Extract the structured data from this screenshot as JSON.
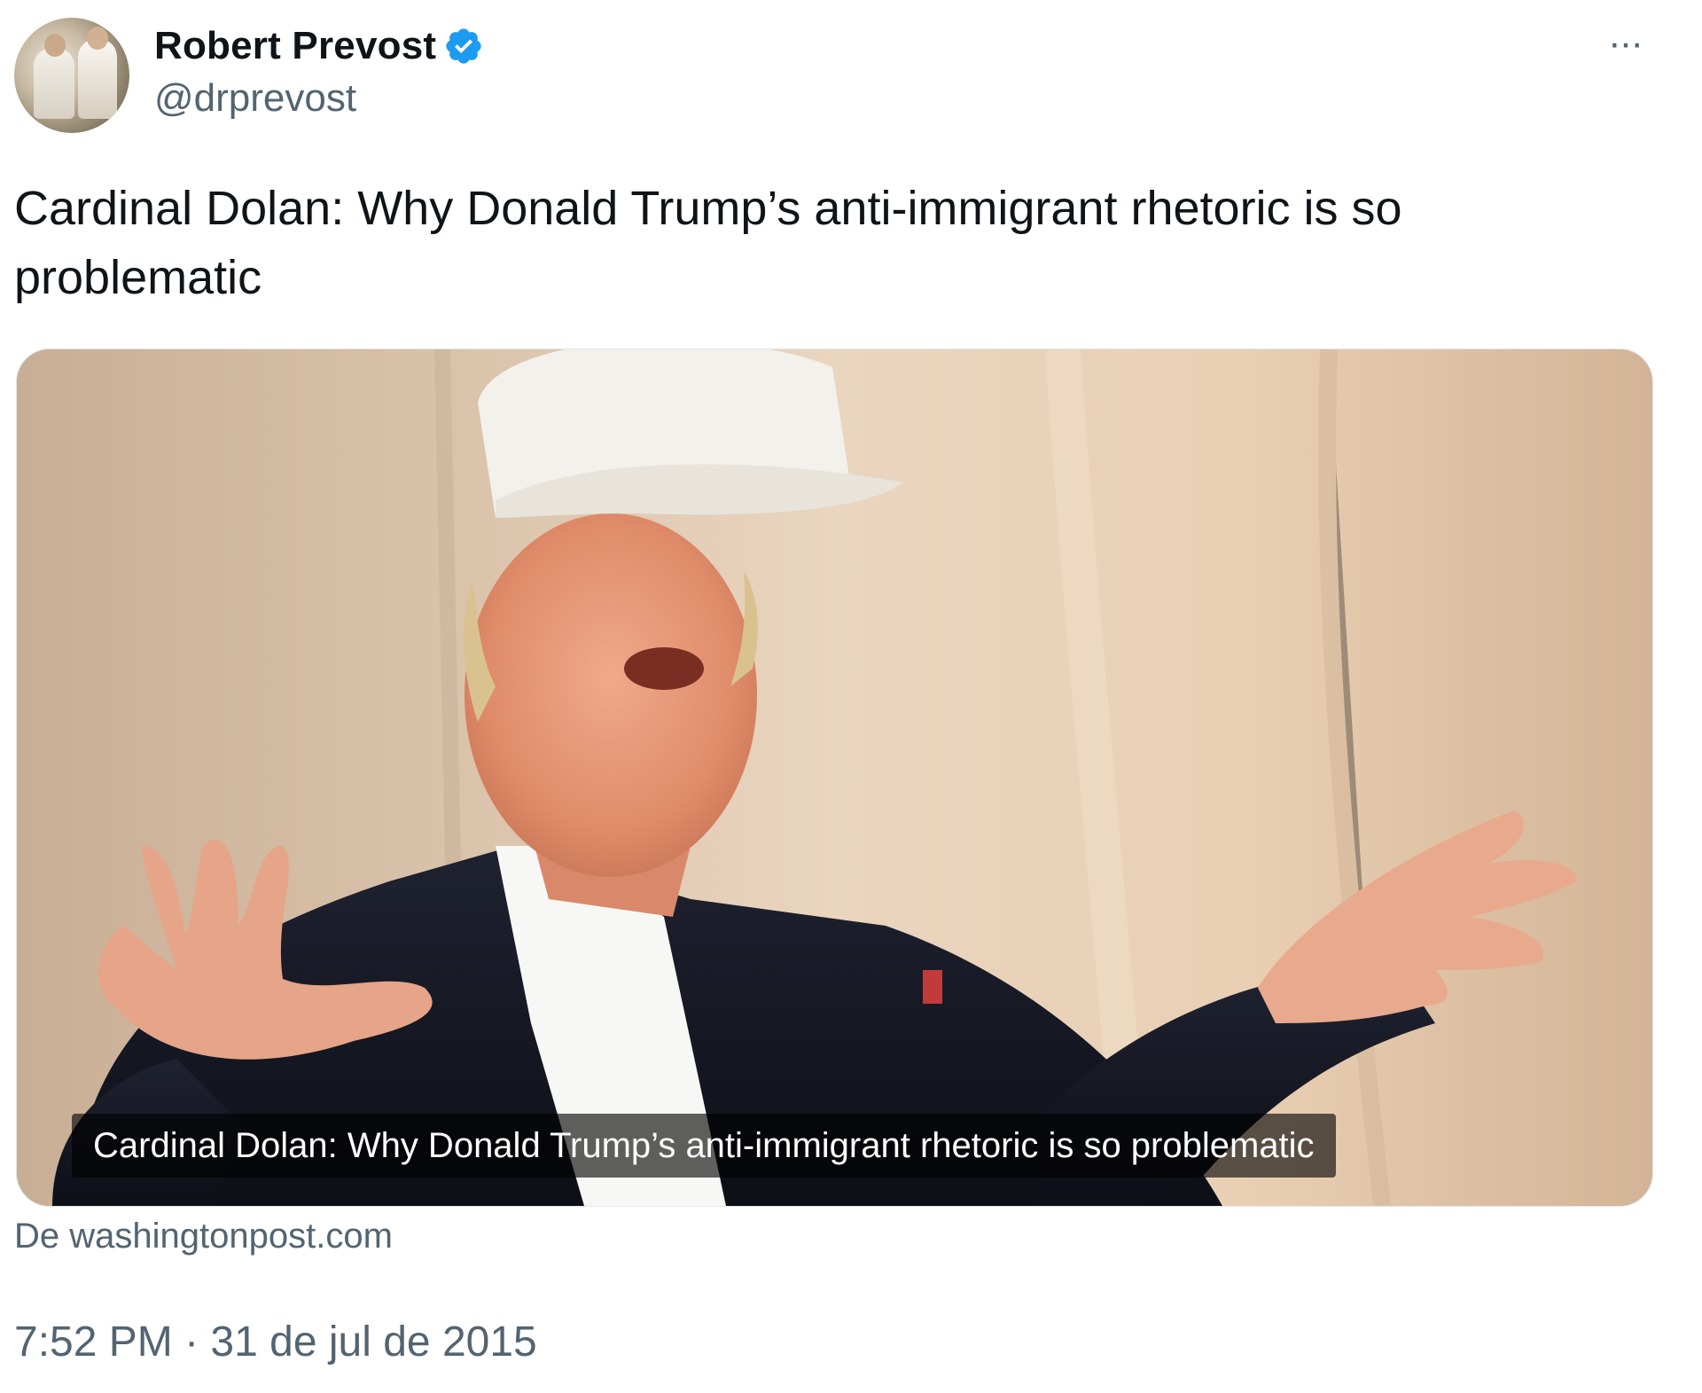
{
  "author": {
    "name": "Robert Prevost",
    "handle": "@drprevost",
    "verified": true
  },
  "tweet": {
    "text": "Cardinal Dolan: Why Donald Trump’s anti-immigrant rhetoric is so problematic",
    "timestamp": "7:52 PM · 31 de jul de 2015"
  },
  "link_card": {
    "title": "Cardinal Dolan: Why Donald Trump’s anti-immigrant rhetoric is so problematic",
    "source": "De washingtonpost.com"
  },
  "icons": {
    "verified": "verified-badge-icon",
    "more": "more-options-icon"
  },
  "colors": {
    "verified_blue": "#1d9bf0",
    "secondary_text": "#536471",
    "primary_text": "#0f1419"
  },
  "more_label": "···"
}
